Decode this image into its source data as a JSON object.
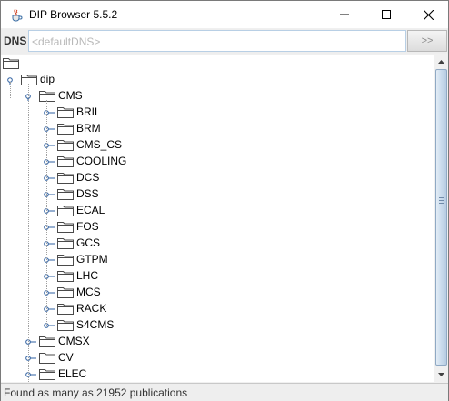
{
  "window": {
    "title": "DIP Browser 5.5.2",
    "icon": "java-coffee-icon"
  },
  "dns": {
    "label": "DNS",
    "placeholder": "<defaultDNS>",
    "go_button": ">>"
  },
  "tree": {
    "root": "dip",
    "level1_first": "CMS",
    "cms_children": [
      "BRIL",
      "BRM",
      "CMS_CS",
      "COOLING",
      "DCS",
      "DSS",
      "ECAL",
      "FOS",
      "GCS",
      "GTPM",
      "LHC",
      "MCS",
      "RACK",
      "S4CMS"
    ],
    "level1_rest": [
      "CMSX",
      "CV",
      "ELEC"
    ]
  },
  "status": {
    "text": "Found as many as 21952 publications"
  },
  "colors": {
    "thumb": "#c9dbec",
    "input_border": "#b8cfe5",
    "close_x": "#000000"
  }
}
